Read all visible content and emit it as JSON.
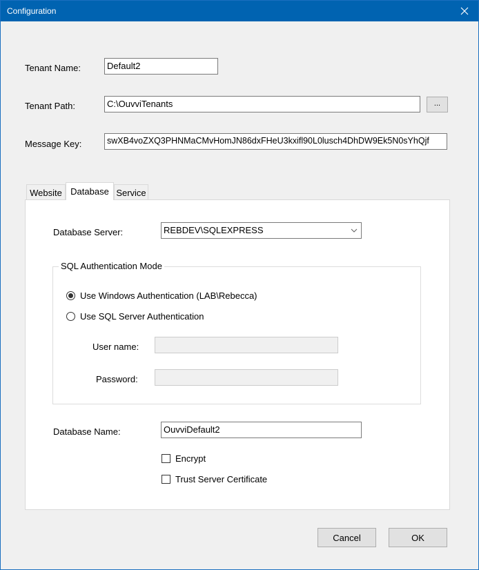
{
  "window": {
    "title": "Configuration",
    "close_icon": "close-icon"
  },
  "tenant": {
    "name_label": "Tenant Name:",
    "name_value": "Default2",
    "path_label": "Tenant Path:",
    "path_value": "C:\\OuvviTenants",
    "browse_label": "...",
    "message_key_label": "Message Key:",
    "message_key_value": "swXB4voZXQ3PHNMaCMvHomJN86dxFHeU3kxifl90L0lusch4DhDW9Ek5N0sYhQjf"
  },
  "tabs": [
    {
      "label": "Website",
      "active": false
    },
    {
      "label": "Database",
      "active": true
    },
    {
      "label": "Service",
      "active": false
    }
  ],
  "database": {
    "server_label": "Database Server:",
    "server_value": "REBDEV\\SQLEXPRESS",
    "auth_group_label": "SQL Authentication Mode",
    "auth_options": [
      {
        "label": "Use Windows Authentication (LAB\\Rebecca)",
        "checked": true
      },
      {
        "label": "Use SQL Server Authentication",
        "checked": false
      }
    ],
    "username_label": "User name:",
    "username_value": "",
    "password_label": "Password:",
    "password_value": "",
    "name_label": "Database Name:",
    "name_value": "OuvviDefault2",
    "encrypt_label": "Encrypt",
    "encrypt_checked": false,
    "trust_cert_label": "Trust Server Certificate",
    "trust_cert_checked": false
  },
  "footer": {
    "cancel_label": "Cancel",
    "ok_label": "OK"
  }
}
